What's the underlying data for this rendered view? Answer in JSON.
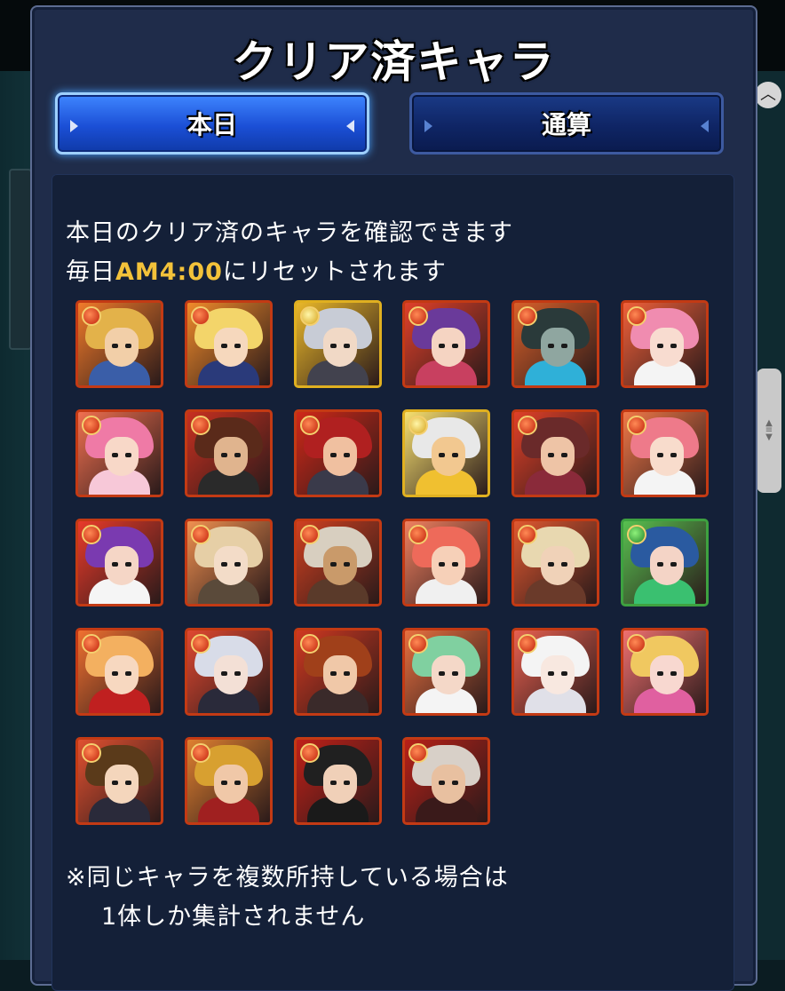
{
  "title": "クリア済キャラ",
  "tabs": [
    {
      "label": "本日",
      "active": true
    },
    {
      "label": "通算",
      "active": false
    }
  ],
  "description": {
    "line1": "本日のクリア済のキャラを確認できます",
    "line2_prefix": "毎日",
    "line2_time": "AM4:00",
    "line2_suffix": "にリセットされます"
  },
  "note": {
    "line1": "※同じキャラを複数所持している場合は",
    "line2": "1体しか集計されません"
  },
  "colors": {
    "accent_time": "#f3c23a",
    "tab_active": "#1b4fd6",
    "tab_inactive": "#0f2565",
    "panel": "#1f2c4a"
  },
  "characters": [
    {
      "element": "fire",
      "hair": "#e3b24a",
      "skin": "#f2cfa8",
      "outfit": "#3a5ea8",
      "bg": "#f07a2a"
    },
    {
      "element": "fire",
      "hair": "#f3d56a",
      "skin": "#f6d8bd",
      "outfit": "#2a3a7a",
      "bg": "#f08a2a"
    },
    {
      "element": "light",
      "hair": "#c8ccd6",
      "skin": "#f1d9c6",
      "outfit": "#42424e",
      "bg": "#e9b72a"
    },
    {
      "element": "fire",
      "hair": "#6a3a9a",
      "skin": "#f5d4c2",
      "outfit": "#c84060",
      "bg": "#e0402a"
    },
    {
      "element": "fire",
      "hair": "#2a3a3a",
      "skin": "#8fa6a0",
      "outfit": "#2fb0d8",
      "bg": "#d8602a"
    },
    {
      "element": "fire",
      "hair": "#f08cb0",
      "skin": "#f8dcd0",
      "outfit": "#f4f4f4",
      "bg": "#f0603a"
    },
    {
      "element": "fire",
      "hair": "#ef7aa6",
      "skin": "#f8d8c8",
      "outfit": "#f7c8d8",
      "bg": "#f07050"
    },
    {
      "element": "fire",
      "hair": "#5a2a1a",
      "skin": "#e0b48e",
      "outfit": "#2a2a2a",
      "bg": "#c83020"
    },
    {
      "element": "fire",
      "hair": "#b02020",
      "skin": "#f0c0a0",
      "outfit": "#3a3a4a",
      "bg": "#d02818"
    },
    {
      "element": "light",
      "hair": "#e8e8e8",
      "skin": "#f2c890",
      "outfit": "#f0c030",
      "bg": "#f7e070"
    },
    {
      "element": "fire",
      "hair": "#6a2a2a",
      "skin": "#eec4a6",
      "outfit": "#8a2a3a",
      "bg": "#e04028"
    },
    {
      "element": "fire",
      "hair": "#ee7a8a",
      "skin": "#f8dccc",
      "outfit": "#f4f4f4",
      "bg": "#f07848"
    },
    {
      "element": "fire",
      "hair": "#7a3ab0",
      "skin": "#f5d6c6",
      "outfit": "#f5f5f5",
      "bg": "#e83a2a"
    },
    {
      "element": "fire",
      "hair": "#e6cfa6",
      "skin": "#f3dcc8",
      "outfit": "#5a4a3a",
      "bg": "#f09050"
    },
    {
      "element": "fire",
      "hair": "#d8cfc0",
      "skin": "#c99a6a",
      "outfit": "#5a3a2a",
      "bg": "#d04020"
    },
    {
      "element": "fire",
      "hair": "#ee6a5a",
      "skin": "#f6d0b8",
      "outfit": "#f0f0f0",
      "bg": "#f08060"
    },
    {
      "element": "fire",
      "hair": "#e8d8b0",
      "skin": "#f0d2b8",
      "outfit": "#6a3a2a",
      "bg": "#e05830"
    },
    {
      "element": "wood",
      "hair": "#2a5aa0",
      "skin": "#f4d4c6",
      "outfit": "#3ac070",
      "bg": "#58c050"
    },
    {
      "element": "fire",
      "hair": "#f3b060",
      "skin": "#f7d8c0",
      "outfit": "#c02020",
      "bg": "#f07030"
    },
    {
      "element": "fire",
      "hair": "#d8dce8",
      "skin": "#f3e0d6",
      "outfit": "#2a2a3a",
      "bg": "#e04830"
    },
    {
      "element": "fire",
      "hair": "#a0401a",
      "skin": "#f0c8a8",
      "outfit": "#3a2a2a",
      "bg": "#d03820"
    },
    {
      "element": "fire",
      "hair": "#80d0a0",
      "skin": "#f4d8c8",
      "outfit": "#f4f4f4",
      "bg": "#e87040"
    },
    {
      "element": "fire",
      "hair": "#f4f4f4",
      "skin": "#f8e8e0",
      "outfit": "#e0e0e8",
      "bg": "#e86050"
    },
    {
      "element": "fire",
      "hair": "#f0c860",
      "skin": "#f8d8d0",
      "outfit": "#e060a0",
      "bg": "#f07070"
    },
    {
      "element": "fire",
      "hair": "#5a3a1a",
      "skin": "#f4d6bc",
      "outfit": "#2a2a3a",
      "bg": "#e05030"
    },
    {
      "element": "fire",
      "hair": "#d8a030",
      "skin": "#f0c8a8",
      "outfit": "#a02020",
      "bg": "#e08030"
    },
    {
      "element": "fire",
      "hair": "#202020",
      "skin": "#f0d0b8",
      "outfit": "#1a1a1a",
      "bg": "#c02018"
    },
    {
      "element": "fire",
      "hair": "#d8d0c8",
      "skin": "#e8c0a0",
      "outfit": "#3a1a1a",
      "bg": "#b82018"
    }
  ]
}
